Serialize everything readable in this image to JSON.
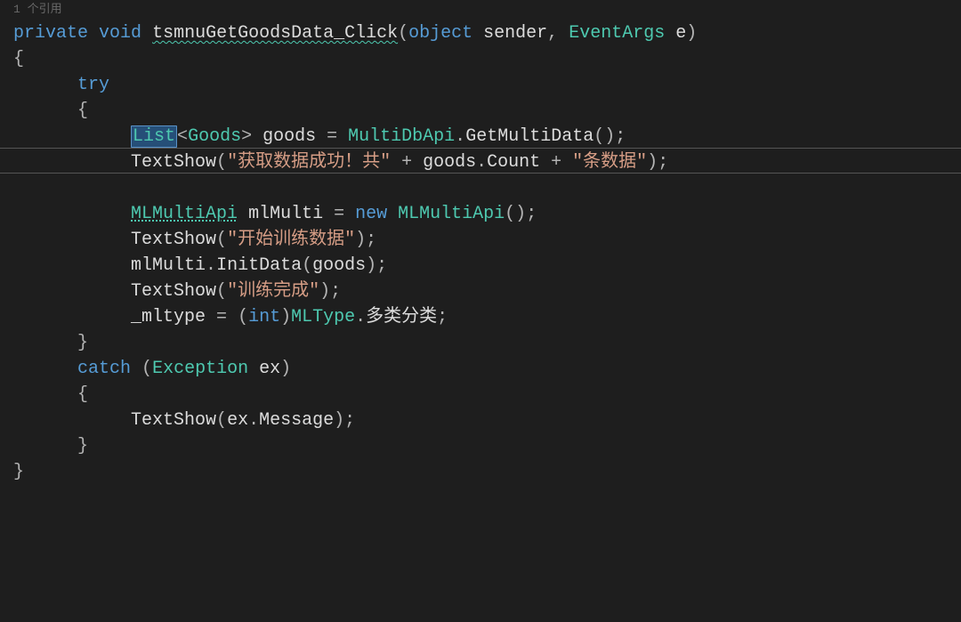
{
  "codelens": "1 个引用",
  "code": {
    "kw_private": "private",
    "kw_void": "void",
    "method_name": "tsmnuGetGoodsData_Click",
    "kw_object": "object",
    "param_sender": "sender",
    "type_eventargs": "EventArgs",
    "param_e": "e",
    "brace_open": "{",
    "brace_close": "}",
    "kw_try": "try",
    "type_list": "List",
    "type_goods": "Goods",
    "var_goods": "goods",
    "type_multidbapi": "MultiDbApi",
    "method_getmultidata": "GetMultiData",
    "method_textshow": "TextShow",
    "str_success1": "\"获取数据成功！共\"",
    "prop_count": "Count",
    "str_success2": "\"条数据\"",
    "type_mlmultiapi": "MLMultiApi",
    "var_mlmulti": "mlMulti",
    "kw_new": "new",
    "str_train_start": "\"开始训练数据\"",
    "method_initdata": "InitData",
    "str_train_done": "\"训练完成\"",
    "var_mltype": "_mltype",
    "kw_int": "int",
    "type_mltype": "MLType",
    "enum_multi": "多类分类",
    "kw_catch": "catch",
    "type_exception": "Exception",
    "param_ex": "ex",
    "prop_message": "Message",
    "eq": " = ",
    "plus": " + ",
    "lt": "<",
    "gt": ">",
    "paren_o": "(",
    "paren_c": ")",
    "dot": ".",
    "comma": ", ",
    "semi": ";",
    "paren_empty": "()"
  }
}
